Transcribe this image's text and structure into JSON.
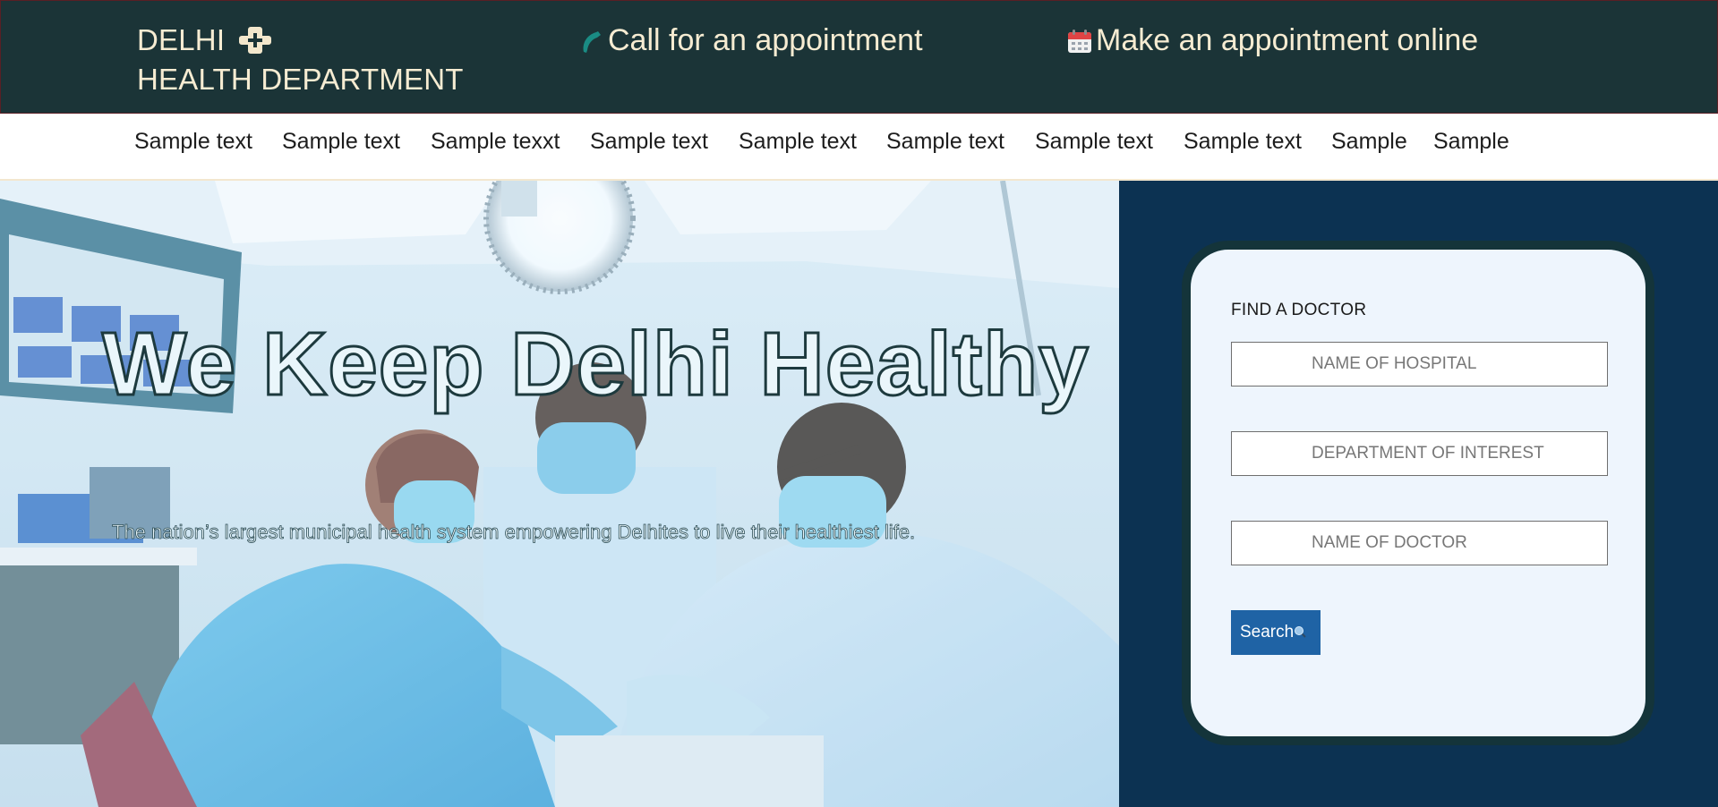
{
  "header": {
    "brand_line1": "DELHI",
    "brand_line2": "HEALTH DEPARTMENT",
    "call_label": "Call for an appointment",
    "online_label": "Make an appointment online"
  },
  "nav": {
    "items": [
      {
        "label": "Sample text"
      },
      {
        "label": "Sample text"
      },
      {
        "label": "Sample texxt"
      },
      {
        "label": "Sample text"
      },
      {
        "label": "Sample text"
      },
      {
        "label": "Sample text"
      },
      {
        "label": "Sample text"
      },
      {
        "label": "Sample text"
      },
      {
        "label": "Sample"
      },
      {
        "label": "Sample"
      }
    ]
  },
  "hero": {
    "title": "We Keep Delhi Healthy",
    "subtitle": "The nation’s largest municipal health system empowering Delhites to live their healthiest life."
  },
  "finder": {
    "title": "FIND A DOCTOR",
    "hospital_placeholder": "NAME OF HOSPITAL",
    "department_placeholder": "DEPARTMENT OF INTEREST",
    "doctor_placeholder": "NAME OF DOCTOR",
    "search_label": "Search"
  },
  "icons": {
    "brand": "medical-cross-icon",
    "call": "phone-icon",
    "online": "calendar-icon",
    "search": "magnifier-icon"
  },
  "colors": {
    "header_bg": "#1b3437",
    "header_text": "#f6ecd2",
    "panel_bg": "#0c3252",
    "card_bg": "#eef5fd",
    "card_border": "#14343a",
    "button_bg": "#1f63a5"
  }
}
